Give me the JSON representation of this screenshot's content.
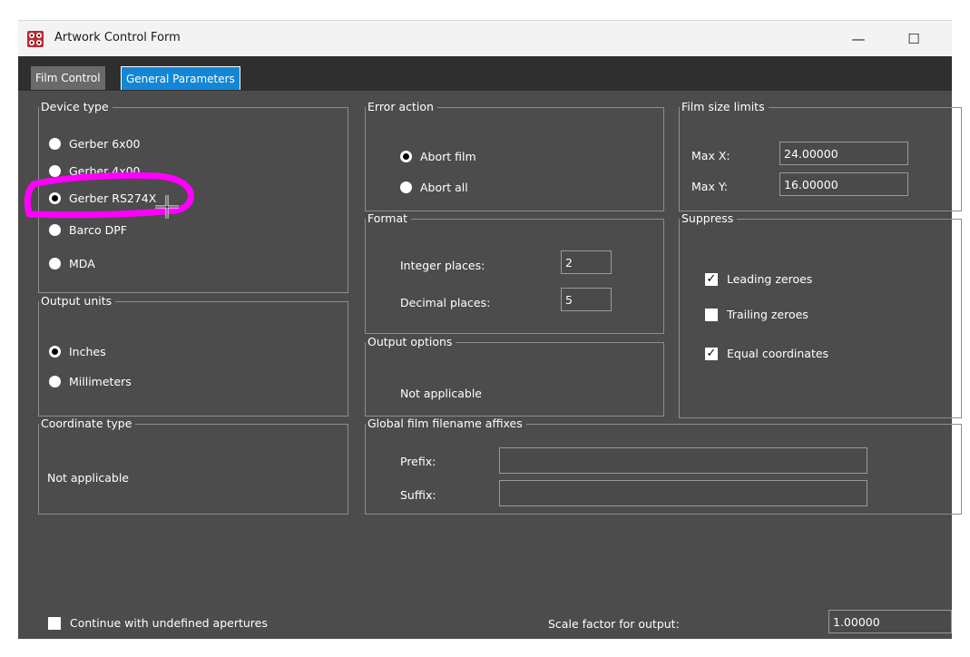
{
  "window": {
    "title": "Artwork Control Form",
    "minimize_glyph": "—",
    "maximize_glyph": "☐"
  },
  "tabs": [
    {
      "label": "Film Control",
      "active": false
    },
    {
      "label": "General Parameters",
      "active": true
    }
  ],
  "device_type": {
    "legend": "Device type",
    "options": [
      "Gerber 6x00",
      "Gerber 4x00",
      "Gerber RS274X",
      "Barco DPF",
      "MDA"
    ],
    "selected": "Gerber RS274X"
  },
  "output_units": {
    "legend": "Output units",
    "options": [
      "Inches",
      "Millimeters"
    ],
    "selected": "Inches"
  },
  "coordinate_type": {
    "legend": "Coordinate type",
    "text": "Not applicable"
  },
  "error_action": {
    "legend": "Error action",
    "options": [
      "Abort film",
      "Abort all"
    ],
    "selected": "Abort film"
  },
  "format": {
    "legend": "Format",
    "integer_label": "Integer places:",
    "integer_value": "2",
    "decimal_label": "Decimal places:",
    "decimal_value": "5"
  },
  "output_options": {
    "legend": "Output options",
    "text": "Not applicable"
  },
  "film_size_limits": {
    "legend": "Film size limits",
    "max_x_label": "Max X:",
    "max_x_value": "24.00000",
    "max_y_label": "Max Y:",
    "max_y_value": "16.00000"
  },
  "suppress": {
    "legend": "Suppress",
    "items": [
      {
        "label": "Leading zeroes",
        "checked": true
      },
      {
        "label": "Trailing zeroes",
        "checked": false
      },
      {
        "label": "Equal coordinates",
        "checked": true
      }
    ]
  },
  "affixes": {
    "legend": "Global film filename affixes",
    "prefix_label": "Prefix:",
    "prefix_value": "",
    "suffix_label": "Suffix:",
    "suffix_value": ""
  },
  "bottom": {
    "continue_label": "Continue with undefined apertures",
    "continue_checked": false,
    "scale_label": "Scale factor for output:",
    "scale_value": "1.00000"
  },
  "colors": {
    "panel": "#4c4c4c",
    "tab_active": "#1387d6",
    "annotation": "#ff00ff"
  },
  "icons": {
    "app": "app-logo-icon",
    "cursor": "crosshair-cursor-icon"
  }
}
